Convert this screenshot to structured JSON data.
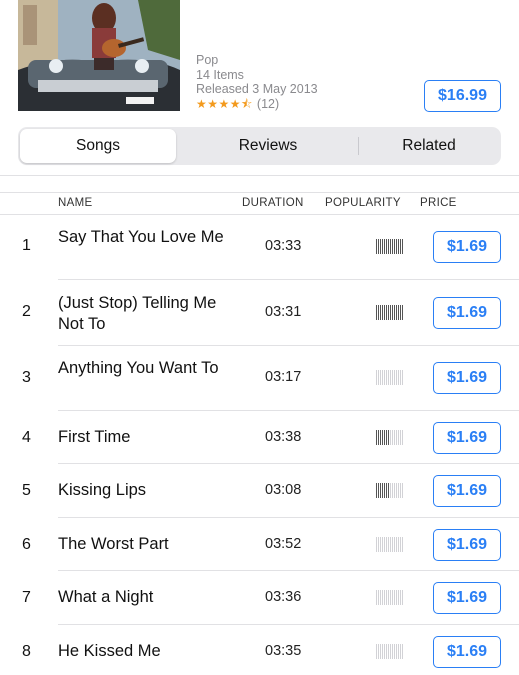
{
  "album": {
    "art_alt": "",
    "genre": "Pop",
    "items": "14 Items",
    "released": "Released 3 May 2013",
    "stars": "★★★★⯪",
    "rating_count": "(12)",
    "price": "$16.99"
  },
  "tabs": [
    {
      "label": "Songs",
      "active": true
    },
    {
      "label": "Reviews",
      "active": false
    },
    {
      "label": "Related",
      "active": false
    }
  ],
  "columns": {
    "name": "NAME",
    "duration": "DURATION",
    "popularity": "POPULARITY",
    "price": "PRICE"
  },
  "tracks": [
    {
      "num": "1",
      "title": "Say That You Love Me",
      "duration": "03:33",
      "popularity": 1.0,
      "price": "$1.69"
    },
    {
      "num": "2",
      "title": "(Just Stop) Telling Me Not To",
      "duration": "03:31",
      "popularity": 1.0,
      "price": "$1.69"
    },
    {
      "num": "3",
      "title": "Anything You Want To",
      "duration": "03:17",
      "popularity": 0.0,
      "price": "$1.69"
    },
    {
      "num": "4",
      "title": "First Time",
      "duration": "03:38",
      "popularity": 0.5,
      "price": "$1.69"
    },
    {
      "num": "5",
      "title": "Kissing Lips",
      "duration": "03:08",
      "popularity": 0.5,
      "price": "$1.69"
    },
    {
      "num": "6",
      "title": "The Worst Part",
      "duration": "03:52",
      "popularity": 0.0,
      "price": "$1.69"
    },
    {
      "num": "7",
      "title": "What a Night",
      "duration": "03:36",
      "popularity": 0.0,
      "price": "$1.69"
    },
    {
      "num": "8",
      "title": "He Kissed Me",
      "duration": "03:35",
      "popularity": 0.0,
      "price": "$1.69"
    }
  ],
  "colors": {
    "accent": "#2a7ff5",
    "stars": "#f39a1d",
    "pop_on": "#555555",
    "pop_off": "#d2d2d6"
  }
}
